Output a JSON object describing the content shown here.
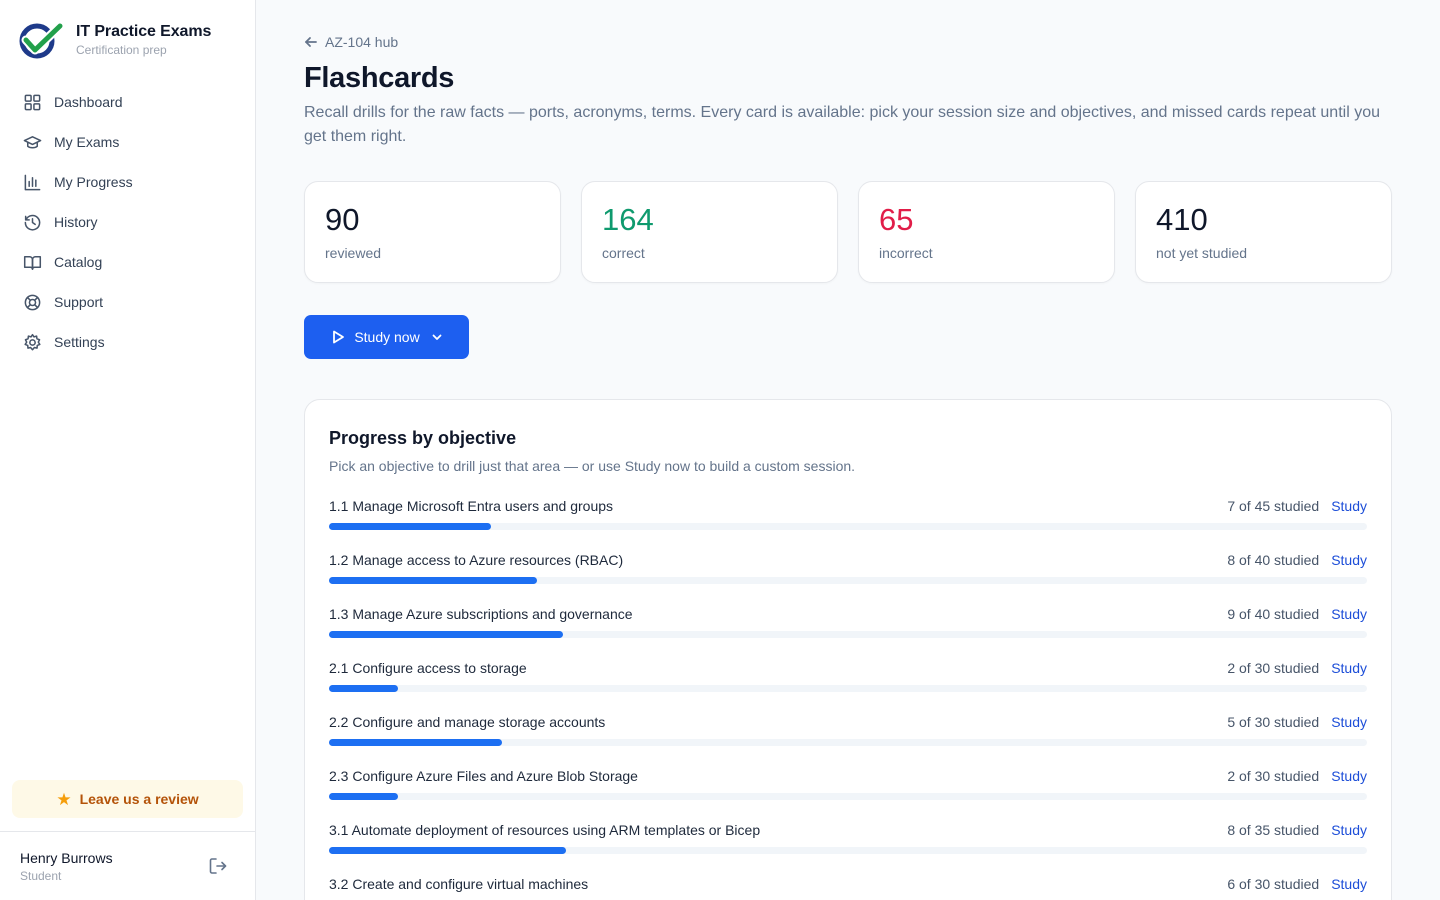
{
  "brand": {
    "name": "IT Practice Exams",
    "subtitle": "Certification prep"
  },
  "nav": [
    {
      "label": "Dashboard",
      "icon": "grid-icon"
    },
    {
      "label": "My Exams",
      "icon": "graduation-cap-icon"
    },
    {
      "label": "My Progress",
      "icon": "bar-chart-icon"
    },
    {
      "label": "History",
      "icon": "history-icon"
    },
    {
      "label": "Catalog",
      "icon": "book-open-icon"
    },
    {
      "label": "Support",
      "icon": "life-buoy-icon"
    },
    {
      "label": "Settings",
      "icon": "gear-icon"
    }
  ],
  "review": {
    "label": "Leave us a review",
    "icon": "star-icon"
  },
  "user": {
    "name": "Henry Burrows",
    "role": "Student"
  },
  "header": {
    "back_label": "AZ-104 hub",
    "title": "Flashcards",
    "description": "Recall drills for the raw facts — ports, acronyms, terms. Every card is available: pick your session size and objectives, and missed cards repeat until you get them right."
  },
  "stats": [
    {
      "value": "90",
      "label": "reviewed",
      "color": "#0f172a"
    },
    {
      "value": "164",
      "label": "correct",
      "color": "#0f9a6e"
    },
    {
      "value": "65",
      "label": "incorrect",
      "color": "#e11d48"
    },
    {
      "value": "410",
      "label": "not yet studied",
      "color": "#0f172a"
    }
  ],
  "study_button": {
    "label": "Study now"
  },
  "progress": {
    "title": "Progress by objective",
    "subtitle": "Pick an objective to drill just that area — or use Study now to build a custom session.",
    "study_label": "Study",
    "objectives": [
      {
        "name": "1.1 Manage Microsoft Entra users and groups",
        "studied": 7,
        "total": 45,
        "count_text": "7 of 45 studied"
      },
      {
        "name": "1.2 Manage access to Azure resources (RBAC)",
        "studied": 8,
        "total": 40,
        "count_text": "8 of 40 studied"
      },
      {
        "name": "1.3 Manage Azure subscriptions and governance",
        "studied": 9,
        "total": 40,
        "count_text": "9 of 40 studied"
      },
      {
        "name": "2.1 Configure access to storage",
        "studied": 2,
        "total": 30,
        "count_text": "2 of 30 studied"
      },
      {
        "name": "2.2 Configure and manage storage accounts",
        "studied": 5,
        "total": 30,
        "count_text": "5 of 30 studied"
      },
      {
        "name": "2.3 Configure Azure Files and Azure Blob Storage",
        "studied": 2,
        "total": 30,
        "count_text": "2 of 30 studied"
      },
      {
        "name": "3.1 Automate deployment of resources using ARM templates or Bicep",
        "studied": 8,
        "total": 35,
        "count_text": "8 of 35 studied"
      },
      {
        "name": "3.2 Create and configure virtual machines",
        "studied": 6,
        "total": 30,
        "count_text": "6 of 30 studied"
      }
    ]
  },
  "colors": {
    "accent": "#1d5ff0",
    "bar": "#1d6ff2",
    "correct": "#0f9a6e",
    "incorrect": "#e11d48"
  }
}
